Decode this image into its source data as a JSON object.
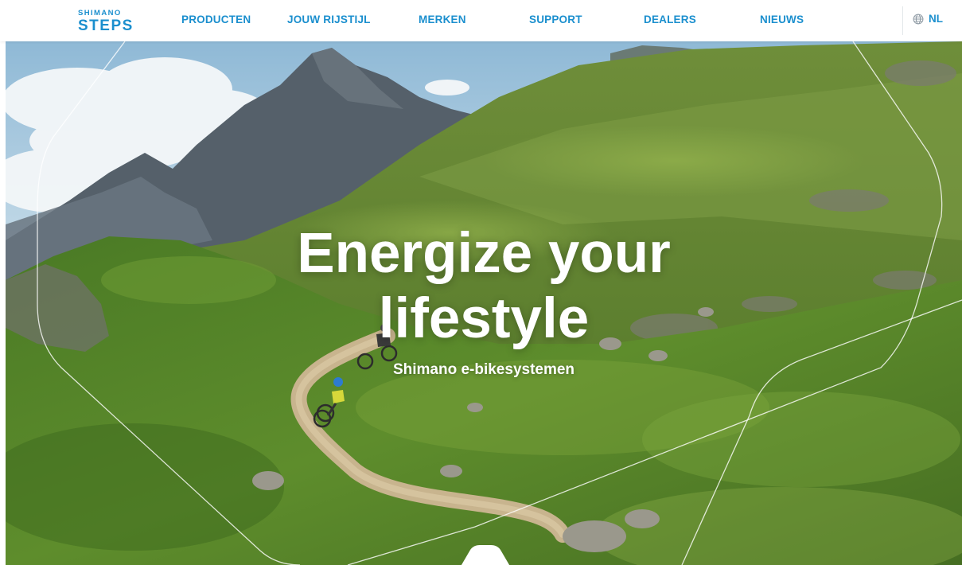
{
  "brand": {
    "logo_top": "SHIMANO",
    "logo_bottom": "STEPS"
  },
  "nav": {
    "items": [
      {
        "label": "PRODUCTEN"
      },
      {
        "label": "JOUW RIJSTIJL"
      },
      {
        "label": "MERKEN"
      },
      {
        "label": "SUPPORT"
      },
      {
        "label": "DEALERS"
      },
      {
        "label": "NIEUWS"
      }
    ],
    "language": {
      "icon": "globe-icon",
      "label": "NL"
    }
  },
  "hero": {
    "title_line1": "Energize your",
    "title_line2": "lifestyle",
    "subtitle": "Shimano e-bikesystemen",
    "scroll_icon": "scroll-down-icon"
  },
  "colors": {
    "brand_blue": "#1b8fce",
    "nav_bg": "#ffffff",
    "hero_text": "#ffffff"
  }
}
